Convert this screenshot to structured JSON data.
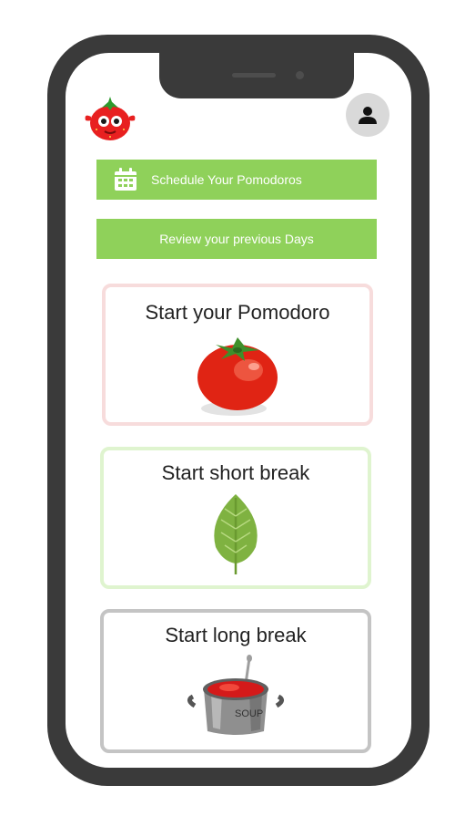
{
  "header": {
    "logo_icon": "strawberry-mascot-icon",
    "profile_icon": "user-icon"
  },
  "actions": {
    "schedule_label": "Schedule Your Pomodoros",
    "schedule_icon": "calendar-icon",
    "review_label": "Review your previous Days"
  },
  "cards": {
    "pomodoro": {
      "label": "Start your Pomodoro",
      "icon": "tomato-icon"
    },
    "short_break": {
      "label": "Start short break",
      "icon": "leaf-icon"
    },
    "long_break": {
      "label": "Start long break",
      "icon": "soup-pot-icon",
      "pot_label": "SOUP"
    }
  },
  "colors": {
    "action_green": "#8fd15a",
    "pomodoro_border": "#f7dcdc",
    "short_break_border": "#dff4cf",
    "long_break_border": "#c4c4c4",
    "phone_frame": "#3a3a3a"
  }
}
